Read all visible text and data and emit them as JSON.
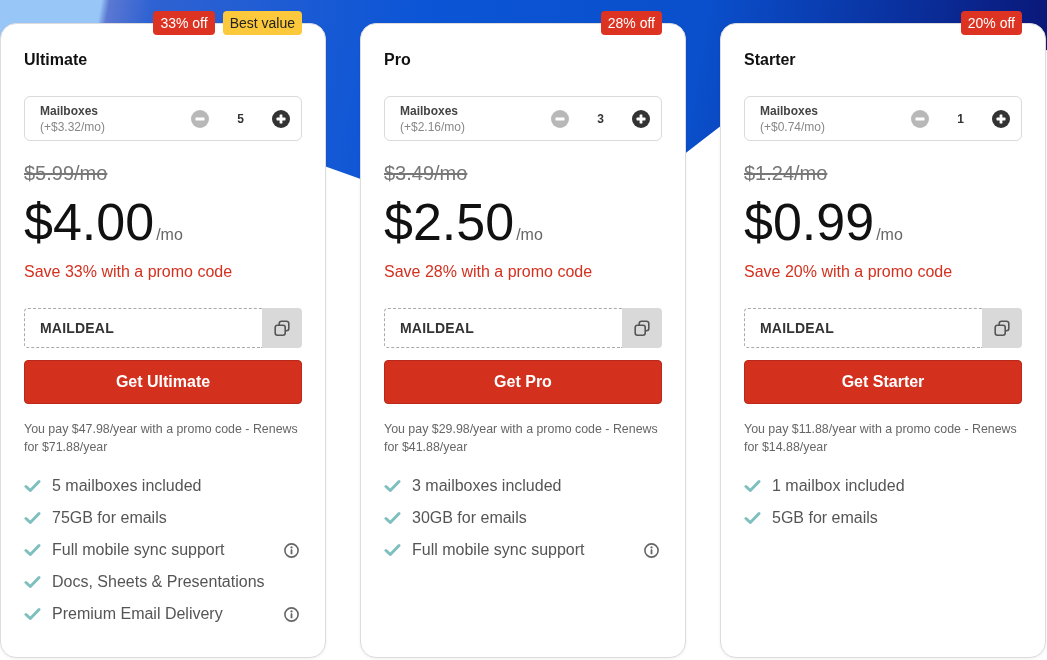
{
  "plans": [
    {
      "badges": [
        {
          "kind": "discount",
          "label": "33% off"
        },
        {
          "kind": "highlight",
          "label": "Best value"
        }
      ],
      "name": "Ultimate",
      "mailboxes": {
        "label": "Mailboxes",
        "price": "(+$3.32/mo)",
        "count": "5",
        "decrease": {
          "disabled": true
        },
        "increase": {
          "disabled": false
        }
      },
      "old_price": "$5.99/mo",
      "price": "$4.00",
      "period": "/mo",
      "promo_text": "Save 33% with a promo code",
      "promo_code": "MAILDEAL",
      "button": "Get Ultimate",
      "billing_note": "You pay $47.98/year with a promo code - Renews for $71.88/year",
      "features": [
        {
          "label": "5 mailboxes included",
          "info": false
        },
        {
          "label": "75GB for emails",
          "info": false
        },
        {
          "label": "Full mobile sync support",
          "info": true
        },
        {
          "label": "Docs, Sheets & Presentations",
          "info": false
        },
        {
          "label": "Premium Email Delivery",
          "info": true
        }
      ]
    },
    {
      "badges": [
        {
          "kind": "discount",
          "label": "28% off"
        }
      ],
      "name": "Pro",
      "mailboxes": {
        "label": "Mailboxes",
        "price": "(+$2.16/mo)",
        "count": "3",
        "decrease": {
          "disabled": true
        },
        "increase": {
          "disabled": false
        }
      },
      "old_price": "$3.49/mo",
      "price": "$2.50",
      "period": "/mo",
      "promo_text": "Save 28% with a promo code",
      "promo_code": "MAILDEAL",
      "button": "Get Pro",
      "billing_note": "You pay $29.98/year with a promo code - Renews for $41.88/year",
      "features": [
        {
          "label": "3 mailboxes included",
          "info": false
        },
        {
          "label": "30GB for emails",
          "info": false
        },
        {
          "label": "Full mobile sync support",
          "info": true
        }
      ]
    },
    {
      "badges": [
        {
          "kind": "discount",
          "label": "20% off"
        }
      ],
      "name": "Starter",
      "mailboxes": {
        "label": "Mailboxes",
        "price": "(+$0.74/mo)",
        "count": "1",
        "decrease": {
          "disabled": true
        },
        "increase": {
          "disabled": false
        }
      },
      "old_price": "$1.24/mo",
      "price": "$0.99",
      "period": "/mo",
      "promo_text": "Save 20% with a promo code",
      "promo_code": "MAILDEAL",
      "button": "Get Starter",
      "billing_note": "You pay $11.88/year with a promo code - Renews for $14.88/year",
      "features": [
        {
          "label": "1 mailbox included",
          "info": false
        },
        {
          "label": "5GB for emails",
          "info": false
        }
      ]
    }
  ]
}
